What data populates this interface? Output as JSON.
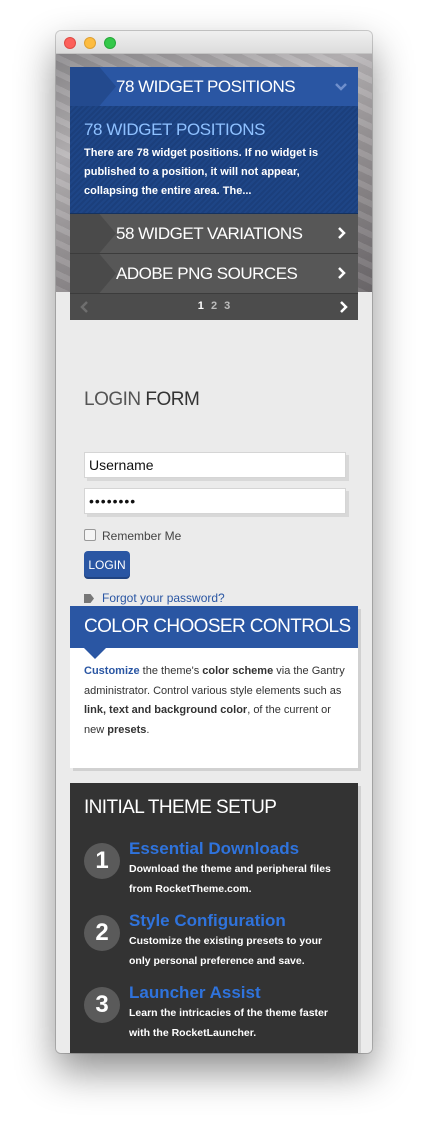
{
  "tabs": [
    {
      "label": "78 Widget Positions",
      "active": true
    },
    {
      "label": "58 Widget Variations",
      "active": false
    },
    {
      "label": "Adobe PNG Sources",
      "active": false
    }
  ],
  "panel": {
    "title": "78 Widget Positions",
    "text": "There are 78 widget positions. If no widget is published to a position, it will not appear, collapsing the entire area. The..."
  },
  "pager": {
    "current": "1",
    "pages": [
      "2",
      "3"
    ]
  },
  "login": {
    "title_light": "Login",
    "title_strong": "Form",
    "username_value": "Username",
    "password_value": "••••••••",
    "remember_label": "Remember Me",
    "button_label": "LOGIN",
    "forgot_label": "Forgot your password?"
  },
  "color_chooser": {
    "title": "Color Chooser Controls",
    "seg1": "Customize",
    "seg2": " the theme's ",
    "seg3": "color scheme",
    "seg4": " via the Gantry administrator. Control various style elements such as ",
    "seg5": "link, text and background color",
    "seg6": ", of the current or new ",
    "seg7": "presets",
    "seg8": "."
  },
  "setup": {
    "title": "Initial Theme Setup",
    "steps": [
      {
        "num": "1",
        "title": "Essential Downloads",
        "desc": "Download the theme and peripheral files from RocketTheme.com."
      },
      {
        "num": "2",
        "title": "Style Configuration",
        "desc": "Customize the existing presets to your only personal preference and save."
      },
      {
        "num": "3",
        "title": "Launcher Assist",
        "desc": "Learn the intricacies of the theme faster with the RocketLauncher."
      }
    ]
  },
  "colors": {
    "accent": "#2a56a3",
    "step_title": "#2f73dc",
    "dark_panel": "#333333"
  }
}
